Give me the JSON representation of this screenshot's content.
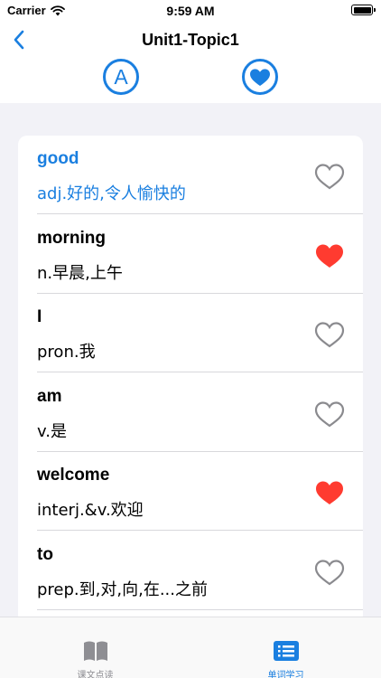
{
  "status_bar": {
    "carrier": "Carrier",
    "time": "9:59 AM"
  },
  "nav": {
    "title": "Unit1-Topic1",
    "toggles": [
      {
        "icon": "letter-a-icon",
        "label": "A"
      },
      {
        "icon": "heart-filter-icon"
      }
    ]
  },
  "words": [
    {
      "word": "good",
      "meaning": "adj.好的,令人愉快的",
      "favorited": false,
      "selected": true
    },
    {
      "word": "morning",
      "meaning": "n.早晨,上午",
      "favorited": true,
      "selected": false
    },
    {
      "word": "I",
      "meaning": "pron.我",
      "favorited": false,
      "selected": false
    },
    {
      "word": "am",
      "meaning": "v.是",
      "favorited": false,
      "selected": false
    },
    {
      "word": "welcome",
      "meaning": "interj.&v.欢迎",
      "favorited": true,
      "selected": false
    },
    {
      "word": "to",
      "meaning": "prep.到,对,向,在...之前",
      "favorited": false,
      "selected": false
    }
  ],
  "tabs": [
    {
      "label": "课文点读",
      "icon": "open-book-icon",
      "active": false
    },
    {
      "label": "单词学习",
      "icon": "list-icon",
      "active": true
    }
  ],
  "colors": {
    "accent": "#1a7fe0",
    "favorite": "#ff3b30",
    "inactive": "#8e8e93",
    "background": "#f2f2f7"
  }
}
